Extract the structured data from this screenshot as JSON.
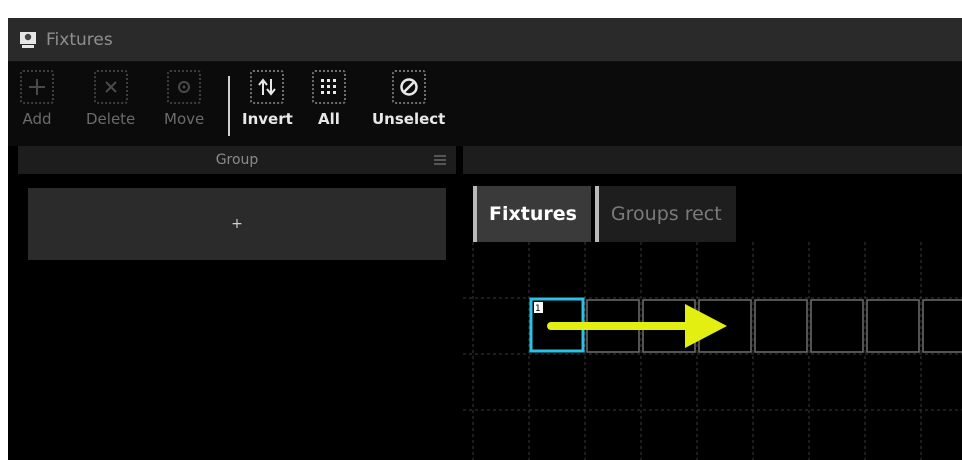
{
  "window": {
    "title": "Fixtures"
  },
  "toolbar": {
    "buttons": [
      {
        "label": "Add",
        "icon": "plus-icon",
        "enabled": false
      },
      {
        "label": "Delete",
        "icon": "x-icon",
        "enabled": false
      },
      {
        "label": "Move",
        "icon": "move-icon",
        "enabled": false
      },
      {
        "label": "Invert",
        "icon": "invert-arrows-icon",
        "enabled": true
      },
      {
        "label": "All",
        "icon": "select-all-icon",
        "enabled": true
      },
      {
        "label": "Unselect",
        "icon": "unselect-icon",
        "enabled": true
      }
    ]
  },
  "group_panel": {
    "header": "Group",
    "add_label": "+"
  },
  "view_panel": {
    "tabs": [
      {
        "label": "Fixtures",
        "active": true
      },
      {
        "label": "Groups rect",
        "active": false
      }
    ],
    "fixture_number": "1",
    "colors": {
      "selected": "#27c4e6",
      "arrow": "#e2ef10",
      "cell_border": "#6f6f6f"
    }
  }
}
